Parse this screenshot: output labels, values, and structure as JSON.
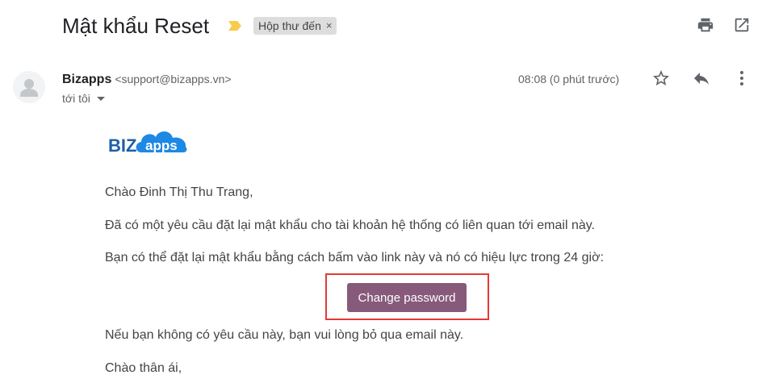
{
  "email": {
    "subject": "Mật khẩu Reset",
    "label_chip": "Hộp thư đến",
    "label_close": "×"
  },
  "toolbar": {
    "print_icon": "print-icon",
    "new_window_icon": "open-in-new-window-icon"
  },
  "sender": {
    "name": "Bizapps",
    "email": "<support@bizapps.vn>",
    "recipient": "tới tôi",
    "timestamp": "08:08 (0 phút trước)"
  },
  "actions": {
    "star_icon": "star-icon",
    "reply_icon": "reply-icon",
    "more_icon": "more-vertical-icon"
  },
  "logo": {
    "text_biz": "BIZ",
    "text_apps": "apps"
  },
  "body": {
    "greeting": "Chào Đinh Thị Thu Trang,",
    "line1": "Đã có một yêu cầu đặt lại mật khẩu cho tài khoản hệ thống có liên quan tới email này.",
    "line2": "Bạn có thể đặt lại mật khẩu bằng cách bấm vào link này và nó có hiệu lực trong 24 giờ:",
    "button_label": "Change password",
    "line3": "Nếu bạn không có yêu cầu này, bạn vui lòng bỏ qua email này.",
    "closing": "Chào thân ái,"
  },
  "colors": {
    "button_bg": "#875a7b",
    "highlight_border": "#e53935",
    "importance_marker": "#f7cb4d",
    "logo_blue": "#1e88e5"
  }
}
